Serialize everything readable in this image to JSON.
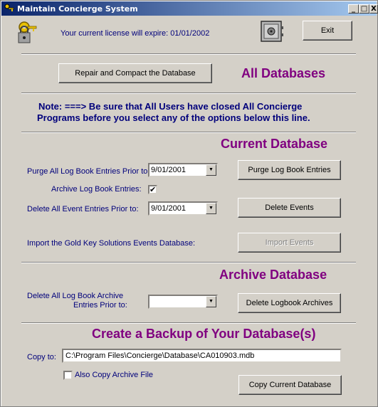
{
  "window": {
    "title": "Maintain Concierge System",
    "controls": {
      "minimize": "_",
      "maximize": "□",
      "close": "X"
    }
  },
  "license_text": "Your current license will expire: 01/01/2002",
  "exit_label": "Exit",
  "repair_label": "Repair and Compact the Database",
  "all_databases_heading": "All  Databases",
  "note_line1": "Note: ===>  Be sure that All Users have closed All Concierge",
  "note_line2": "Programs before you select any of the options below this line.",
  "current": {
    "heading": "Current Database",
    "purge_label": "Purge All Log Book Entries Prior to:",
    "purge_date": "9/01/2001",
    "purge_button": "Purge Log Book Entries",
    "archive_label": "Archive Log Book Entries:",
    "archive_checked": "✔",
    "delete_events_label": "Delete All Event Entries Prior to:",
    "delete_events_date": "9/01/2001",
    "delete_events_button": "Delete Events",
    "import_label": "Import the Gold Key Solutions Events Database:",
    "import_button": "Import Events"
  },
  "archive": {
    "heading": "Archive Database",
    "delete_label_1": "Delete All Log Book Archive",
    "delete_label_2": "Entries Prior to:",
    "delete_date": "",
    "delete_button": "Delete Logbook Archives"
  },
  "backup": {
    "heading": "Create a Backup of Your Database(s)",
    "copy_to_label": "Copy to:",
    "copy_to_path": "C:\\Program Files\\Concierge\\Database\\CA010903.mdb",
    "also_copy_label": "Also Copy Archive File",
    "copy_button": "Copy Current Database"
  },
  "combo_arrow": "▼"
}
